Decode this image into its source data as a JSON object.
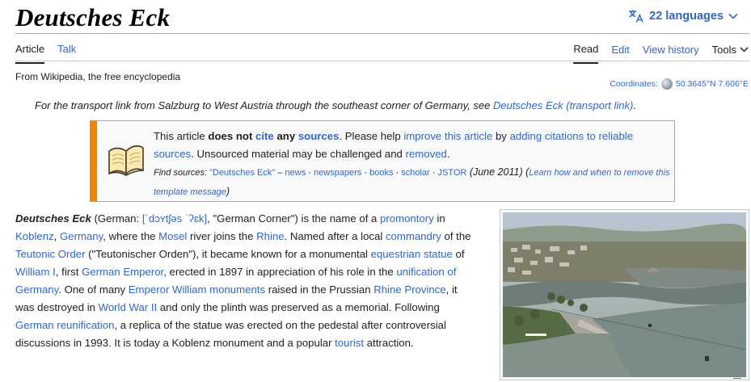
{
  "page": {
    "title": "Deutsches Eck"
  },
  "languages": {
    "label": "22 languages"
  },
  "tabs": {
    "left": [
      {
        "label": "Article"
      },
      {
        "label": "Talk"
      }
    ],
    "right": [
      {
        "label": "Read"
      },
      {
        "label": "Edit"
      },
      {
        "label": "View history"
      },
      {
        "label": "Tools"
      }
    ]
  },
  "tagline": "From Wikipedia, the free encyclopedia",
  "coordinates": {
    "label": "Coordinates:",
    "value": "50.3645°N 7.606°E"
  },
  "hatnote": {
    "text": "For the transport link from Salzburg to West Austria through the southeast corner of Germany, see ",
    "link": "Deutsches Eck (transport link)",
    "end": "."
  },
  "notice": {
    "t1": "This article ",
    "b1": "does not ",
    "l1": "cite",
    "t2": " ",
    "b2": "any ",
    "l2": "sources",
    "t3": ". Please help ",
    "l3": "improve this article",
    "t4": " by ",
    "l4": "adding citations to reliable sources",
    "t5": ". Unsourced material may be challenged and ",
    "l5": "removed",
    "t6": ".",
    "find_label": "Find sources: ",
    "find_query": "\"Deutsches Eck\"",
    "find_sep0": " – ",
    "find_links": [
      "news",
      "newspapers",
      "books",
      "scholar",
      "JSTOR"
    ],
    "date": " (June 2011)",
    "learn_open": " (",
    "learn": "Learn how and when to remove this template message",
    "learn_close": ")"
  },
  "lead": {
    "name": "Deutsches Eck",
    "p1": " (German: ",
    "ipa": "[ˈdɔʏtʃəs ˈʔɛk]",
    "p2": ", \"German Corner\") is the name of a ",
    "l_promontory": "promontory",
    "p3": " in ",
    "l_koblenz": "Koblenz",
    "p4": ", ",
    "l_germany": "Germany",
    "p5": ", where the ",
    "l_mosel": "Mosel",
    "p6": " river joins the ",
    "l_rhine": "Rhine",
    "p7": ". Named after a local ",
    "l_commandry": "commandry",
    "p8": " of the ",
    "l_teutonic": "Teutonic Order",
    "p9": " (\"Teutonischer Orden\"), it became known for a monumental ",
    "l_equestrian": "equestrian statue",
    "p10": " of ",
    "l_william": "William I",
    "p11": ", first ",
    "l_emperor": "German Emperor",
    "p12": ", erected in 1897 in appreciation of his role in the ",
    "l_unification": "unification of Germany",
    "p13": ". One of many ",
    "l_monuments": "Emperor William monuments",
    "p14": " raised in the Prussian ",
    "l_province": "Rhine Province",
    "p15": ", it was destroyed in ",
    "l_ww2": "World War II",
    "p16": " and only the plinth was preserved as a memorial. Following ",
    "l_reunification": "German reunification",
    "p17": ", a replica of the statue was erected on the pedestal after controversial discussions in 1993. It is today a Koblenz monument and a popular ",
    "l_tourist": "tourist",
    "p18": " attraction."
  },
  "colors": {
    "link": "#3366cc",
    "notice_bar": "#f28500",
    "text": "#202122"
  }
}
